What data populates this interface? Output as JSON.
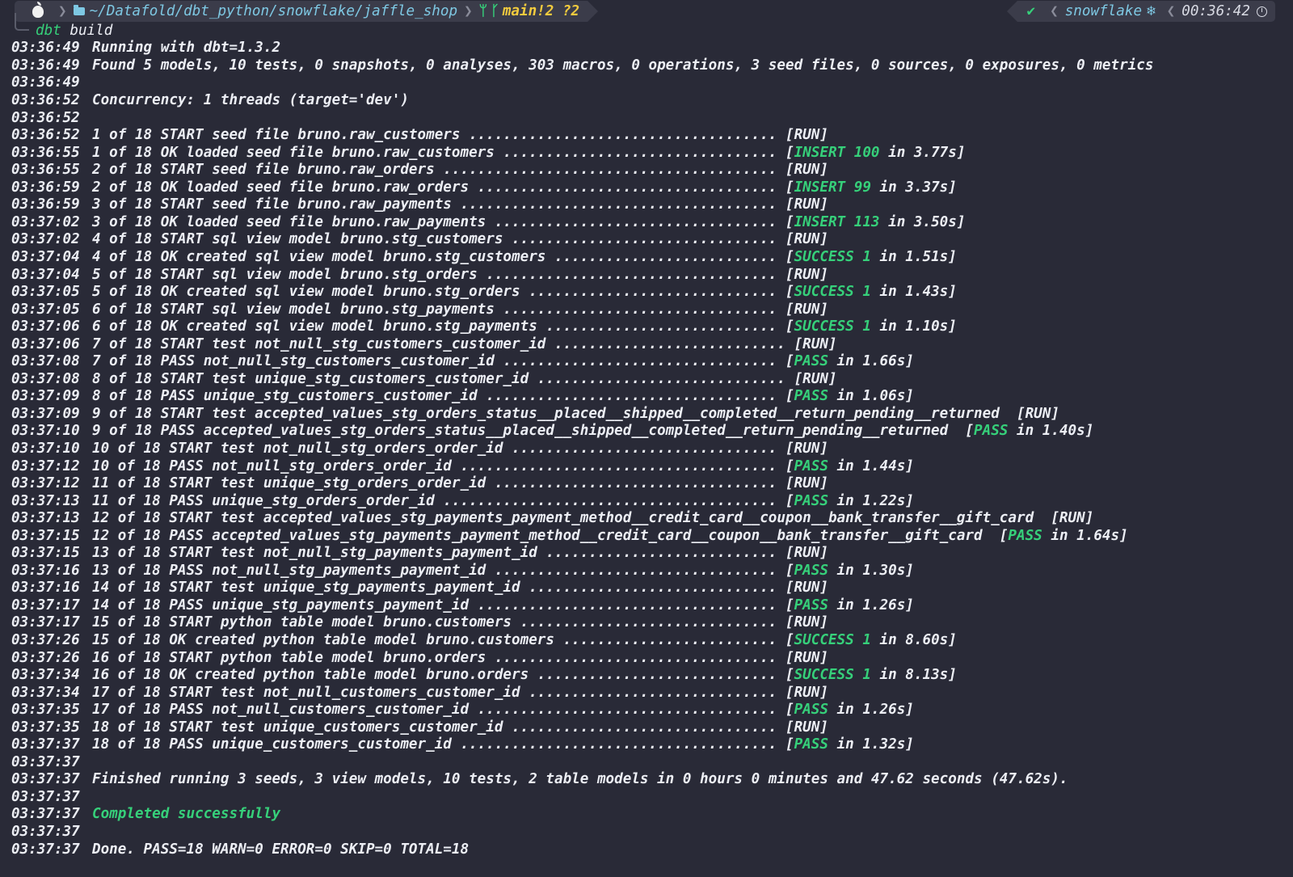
{
  "prompt": {
    "path": "~/Datafold/dbt_python/snowflake/jaffle_shop",
    "branch": "main",
    "git_status": "!2 ?2",
    "env": "snowflake",
    "time": "00:36:42",
    "icons": [
      "apple-icon",
      "folder-icon",
      "git-icon",
      "branch-icon",
      "check-icon",
      "snowflake-icon",
      "clock-icon"
    ]
  },
  "command": {
    "program": "dbt",
    "args": "build"
  },
  "colors": {
    "background": "#292a37",
    "text": "#eceef4",
    "success": "#36d07a",
    "path": "#7ec8e3",
    "branch": "#f2cb3e"
  },
  "log": [
    {
      "ts": "03:36:49",
      "text": "Running with dbt=1.3.2"
    },
    {
      "ts": "03:36:49",
      "text": "Found 5 models, 10 tests, 0 snapshots, 0 analyses, 303 macros, 0 operations, 3 seed files, 0 sources, 0 exposures, 0 metrics"
    },
    {
      "ts": "03:36:49",
      "text": ""
    },
    {
      "ts": "03:36:52",
      "text": "Concurrency: 1 threads (target='dev')"
    },
    {
      "ts": "03:36:52",
      "text": ""
    },
    {
      "ts": "03:36:52",
      "text": "1 of 18 START seed file bruno.raw_customers .................................... ",
      "status": "[RUN]"
    },
    {
      "ts": "03:36:55",
      "text": "1 of 18 OK loaded seed file bruno.raw_customers ................................ ",
      "open": "[",
      "word": "INSERT 100",
      "rest": " in 3.77s]"
    },
    {
      "ts": "03:36:55",
      "text": "2 of 18 START seed file bruno.raw_orders ....................................... ",
      "status": "[RUN]"
    },
    {
      "ts": "03:36:59",
      "text": "2 of 18 OK loaded seed file bruno.raw_orders ................................... ",
      "open": "[",
      "word": "INSERT 99",
      "rest": " in 3.37s]"
    },
    {
      "ts": "03:36:59",
      "text": "3 of 18 START seed file bruno.raw_payments ..................................... ",
      "status": "[RUN]"
    },
    {
      "ts": "03:37:02",
      "text": "3 of 18 OK loaded seed file bruno.raw_payments ................................. ",
      "open": "[",
      "word": "INSERT 113",
      "rest": " in 3.50s]"
    },
    {
      "ts": "03:37:02",
      "text": "4 of 18 START sql view model bruno.stg_customers ............................... ",
      "status": "[RUN]"
    },
    {
      "ts": "03:37:04",
      "text": "4 of 18 OK created sql view model bruno.stg_customers .......................... ",
      "open": "[",
      "word": "SUCCESS 1",
      "rest": " in 1.51s]"
    },
    {
      "ts": "03:37:04",
      "text": "5 of 18 START sql view model bruno.stg_orders .................................. ",
      "status": "[RUN]"
    },
    {
      "ts": "03:37:05",
      "text": "5 of 18 OK created sql view model bruno.stg_orders ............................. ",
      "open": "[",
      "word": "SUCCESS 1",
      "rest": " in 1.43s]"
    },
    {
      "ts": "03:37:05",
      "text": "6 of 18 START sql view model bruno.stg_payments ................................ ",
      "status": "[RUN]"
    },
    {
      "ts": "03:37:06",
      "text": "6 of 18 OK created sql view model bruno.stg_payments ........................... ",
      "open": "[",
      "word": "SUCCESS 1",
      "rest": " in 1.10s]"
    },
    {
      "ts": "03:37:06",
      "text": "7 of 18 START test not_null_stg_customers_customer_id ........................... ",
      "status": "[RUN]"
    },
    {
      "ts": "03:37:08",
      "text": "7 of 18 PASS not_null_stg_customers_customer_id ................................ ",
      "open": "[",
      "word": "PASS",
      "rest": " in 1.66s]"
    },
    {
      "ts": "03:37:08",
      "text": "8 of 18 START test unique_stg_customers_customer_id ............................. ",
      "status": "[RUN]"
    },
    {
      "ts": "03:37:09",
      "text": "8 of 18 PASS unique_stg_customers_customer_id .................................. ",
      "open": "[",
      "word": "PASS",
      "rest": " in 1.06s]"
    },
    {
      "ts": "03:37:09",
      "text": "9 of 18 START test accepted_values_stg_orders_status__placed__shipped__completed__return_pending__returned  ",
      "status": "[RUN]"
    },
    {
      "ts": "03:37:10",
      "text": "9 of 18 PASS accepted_values_stg_orders_status__placed__shipped__completed__return_pending__returned  ",
      "open": "[",
      "word": "PASS",
      "rest": " in 1.40s]"
    },
    {
      "ts": "03:37:10",
      "text": "10 of 18 START test not_null_stg_orders_order_id ............................... ",
      "status": "[RUN]"
    },
    {
      "ts": "03:37:12",
      "text": "10 of 18 PASS not_null_stg_orders_order_id ..................................... ",
      "open": "[",
      "word": "PASS",
      "rest": " in 1.44s]"
    },
    {
      "ts": "03:37:12",
      "text": "11 of 18 START test unique_stg_orders_order_id ................................. ",
      "status": "[RUN]"
    },
    {
      "ts": "03:37:13",
      "text": "11 of 18 PASS unique_stg_orders_order_id ....................................... ",
      "open": "[",
      "word": "PASS",
      "rest": " in 1.22s]"
    },
    {
      "ts": "03:37:13",
      "text": "12 of 18 START test accepted_values_stg_payments_payment_method__credit_card__coupon__bank_transfer__gift_card  ",
      "status": "[RUN]"
    },
    {
      "ts": "03:37:15",
      "text": "12 of 18 PASS accepted_values_stg_payments_payment_method__credit_card__coupon__bank_transfer__gift_card  ",
      "open": "[",
      "word": "PASS",
      "rest": " in 1.64s]"
    },
    {
      "ts": "03:37:15",
      "text": "13 of 18 START test not_null_stg_payments_payment_id ........................... ",
      "status": "[RUN]"
    },
    {
      "ts": "03:37:16",
      "text": "13 of 18 PASS not_null_stg_payments_payment_id ................................. ",
      "open": "[",
      "word": "PASS",
      "rest": " in 1.30s]"
    },
    {
      "ts": "03:37:16",
      "text": "14 of 18 START test unique_stg_payments_payment_id ............................. ",
      "status": "[RUN]"
    },
    {
      "ts": "03:37:17",
      "text": "14 of 18 PASS unique_stg_payments_payment_id ................................... ",
      "open": "[",
      "word": "PASS",
      "rest": " in 1.26s]"
    },
    {
      "ts": "03:37:17",
      "text": "15 of 18 START python table model bruno.customers .............................. ",
      "status": "[RUN]"
    },
    {
      "ts": "03:37:26",
      "text": "15 of 18 OK created python table model bruno.customers ......................... ",
      "open": "[",
      "word": "SUCCESS 1",
      "rest": " in 8.60s]"
    },
    {
      "ts": "03:37:26",
      "text": "16 of 18 START python table model bruno.orders ................................. ",
      "status": "[RUN]"
    },
    {
      "ts": "03:37:34",
      "text": "16 of 18 OK created python table model bruno.orders ............................ ",
      "open": "[",
      "word": "SUCCESS 1",
      "rest": " in 8.13s]"
    },
    {
      "ts": "03:37:34",
      "text": "17 of 18 START test not_null_customers_customer_id ............................. ",
      "status": "[RUN]"
    },
    {
      "ts": "03:37:35",
      "text": "17 of 18 PASS not_null_customers_customer_id ................................... ",
      "open": "[",
      "word": "PASS",
      "rest": " in 1.26s]"
    },
    {
      "ts": "03:37:35",
      "text": "18 of 18 START test unique_customers_customer_id ............................... ",
      "status": "[RUN]"
    },
    {
      "ts": "03:37:37",
      "text": "18 of 18 PASS unique_customers_customer_id ..................................... ",
      "open": "[",
      "word": "PASS",
      "rest": " in 1.32s]"
    },
    {
      "ts": "03:37:37",
      "text": ""
    },
    {
      "ts": "03:37:37",
      "text": "Finished running 3 seeds, 3 view models, 10 tests, 2 table models in 0 hours 0 minutes and 47.62 seconds (47.62s)."
    },
    {
      "ts": "03:37:37",
      "text": ""
    },
    {
      "ts": "03:37:37",
      "text": "",
      "green": "Completed successfully"
    },
    {
      "ts": "03:37:37",
      "text": ""
    },
    {
      "ts": "03:37:37",
      "text": "Done. PASS=18 WARN=0 ERROR=0 SKIP=0 TOTAL=18"
    }
  ]
}
